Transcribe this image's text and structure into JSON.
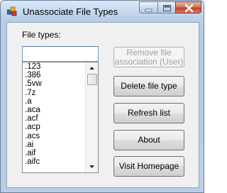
{
  "window": {
    "title": "Unassociate File Types"
  },
  "icons": {
    "app": "file-types-app-icon",
    "minimize": "minimize-icon",
    "maximize": "maximize-icon",
    "close": "close-icon"
  },
  "form": {
    "file_types_label": "File types:",
    "filter_value": "",
    "file_types": [
      ".123",
      ".386",
      ".5vw",
      ".7z",
      ".a",
      ".aca",
      ".acf",
      ".acp",
      ".acs",
      ".ai",
      ".aif",
      ".aifc"
    ]
  },
  "buttons": {
    "remove_association": "Remove file association (User)",
    "delete_file_type": "Delete file type",
    "refresh_list": "Refresh list",
    "about": "About",
    "visit_homepage": "Visit Homepage"
  },
  "colors": {
    "close_button": "#c0432b",
    "disabled_text": "#a0a0a0"
  }
}
